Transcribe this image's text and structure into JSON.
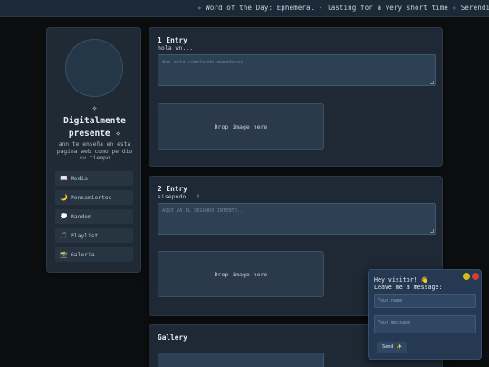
{
  "ticker": {
    "text": "✧ Word of the Day: Ephemeral - lasting for a very short time ✧ Serendipity - f"
  },
  "sidebar": {
    "title_line1": "✧",
    "title_line2": "Digitalmente",
    "title_line3": "presente ✧",
    "tagline": "ann te enseña en esta pagina web como perdio su tiempo",
    "items": [
      {
        "icon": "📖",
        "label": "Media"
      },
      {
        "icon": "🌙",
        "label": "Pensamientos"
      },
      {
        "icon": "💭",
        "label": "Random"
      },
      {
        "icon": "🎵",
        "label": "Playlist"
      },
      {
        "icon": "📸",
        "label": "Galeria"
      }
    ]
  },
  "entries": [
    {
      "title": "1 Entry",
      "subtitle": "hola wn...",
      "textarea_placeholder": "Ann esta cometendo mamadoras",
      "drop_label": "Drop image here"
    },
    {
      "title": "2 Entry",
      "subtitle": "sisepudo...!",
      "textarea_placeholder": "AQUI VA EL SEGUNDO INTENTO...",
      "drop_label": "Drop image here"
    }
  ],
  "gallery": {
    "title": "Gallery"
  },
  "chat": {
    "greeting": "Hey visitor! 👋",
    "prompt": "Leave me a message:",
    "name_placeholder": "Your name",
    "message_placeholder": "Your message",
    "send_label": "Send ✨",
    "colors": {
      "minimize": "#d4b820",
      "close": "#d83a3a"
    }
  }
}
